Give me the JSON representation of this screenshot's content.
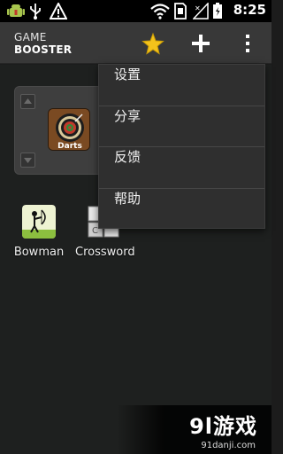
{
  "status_bar": {
    "time": "8:25",
    "icons": [
      "android-debug-icon",
      "usb-icon",
      "warning-icon",
      "wifi-icon",
      "sd-card-icon",
      "signal-icon",
      "battery-icon"
    ]
  },
  "action_bar": {
    "logo_top": "GAME",
    "logo_bottom": "BOOSTER",
    "icons": [
      "star-icon",
      "add-icon",
      "overflow-menu-icon"
    ],
    "accent": "#f3c21b"
  },
  "folder": {
    "icons": [
      "arrow-up-icon",
      "darts-icon",
      "arrow-down-icon"
    ],
    "darts_label": "Darts"
  },
  "apps": [
    {
      "label": "Bowman",
      "icon": "bowman-icon"
    },
    {
      "label": "Crossword",
      "icon": "crossword-icon"
    }
  ],
  "menu": {
    "items": [
      "设置",
      "分享",
      "反馈",
      "帮助"
    ]
  },
  "watermark": {
    "main": "9l游戏",
    "sub": "91danji.com"
  }
}
